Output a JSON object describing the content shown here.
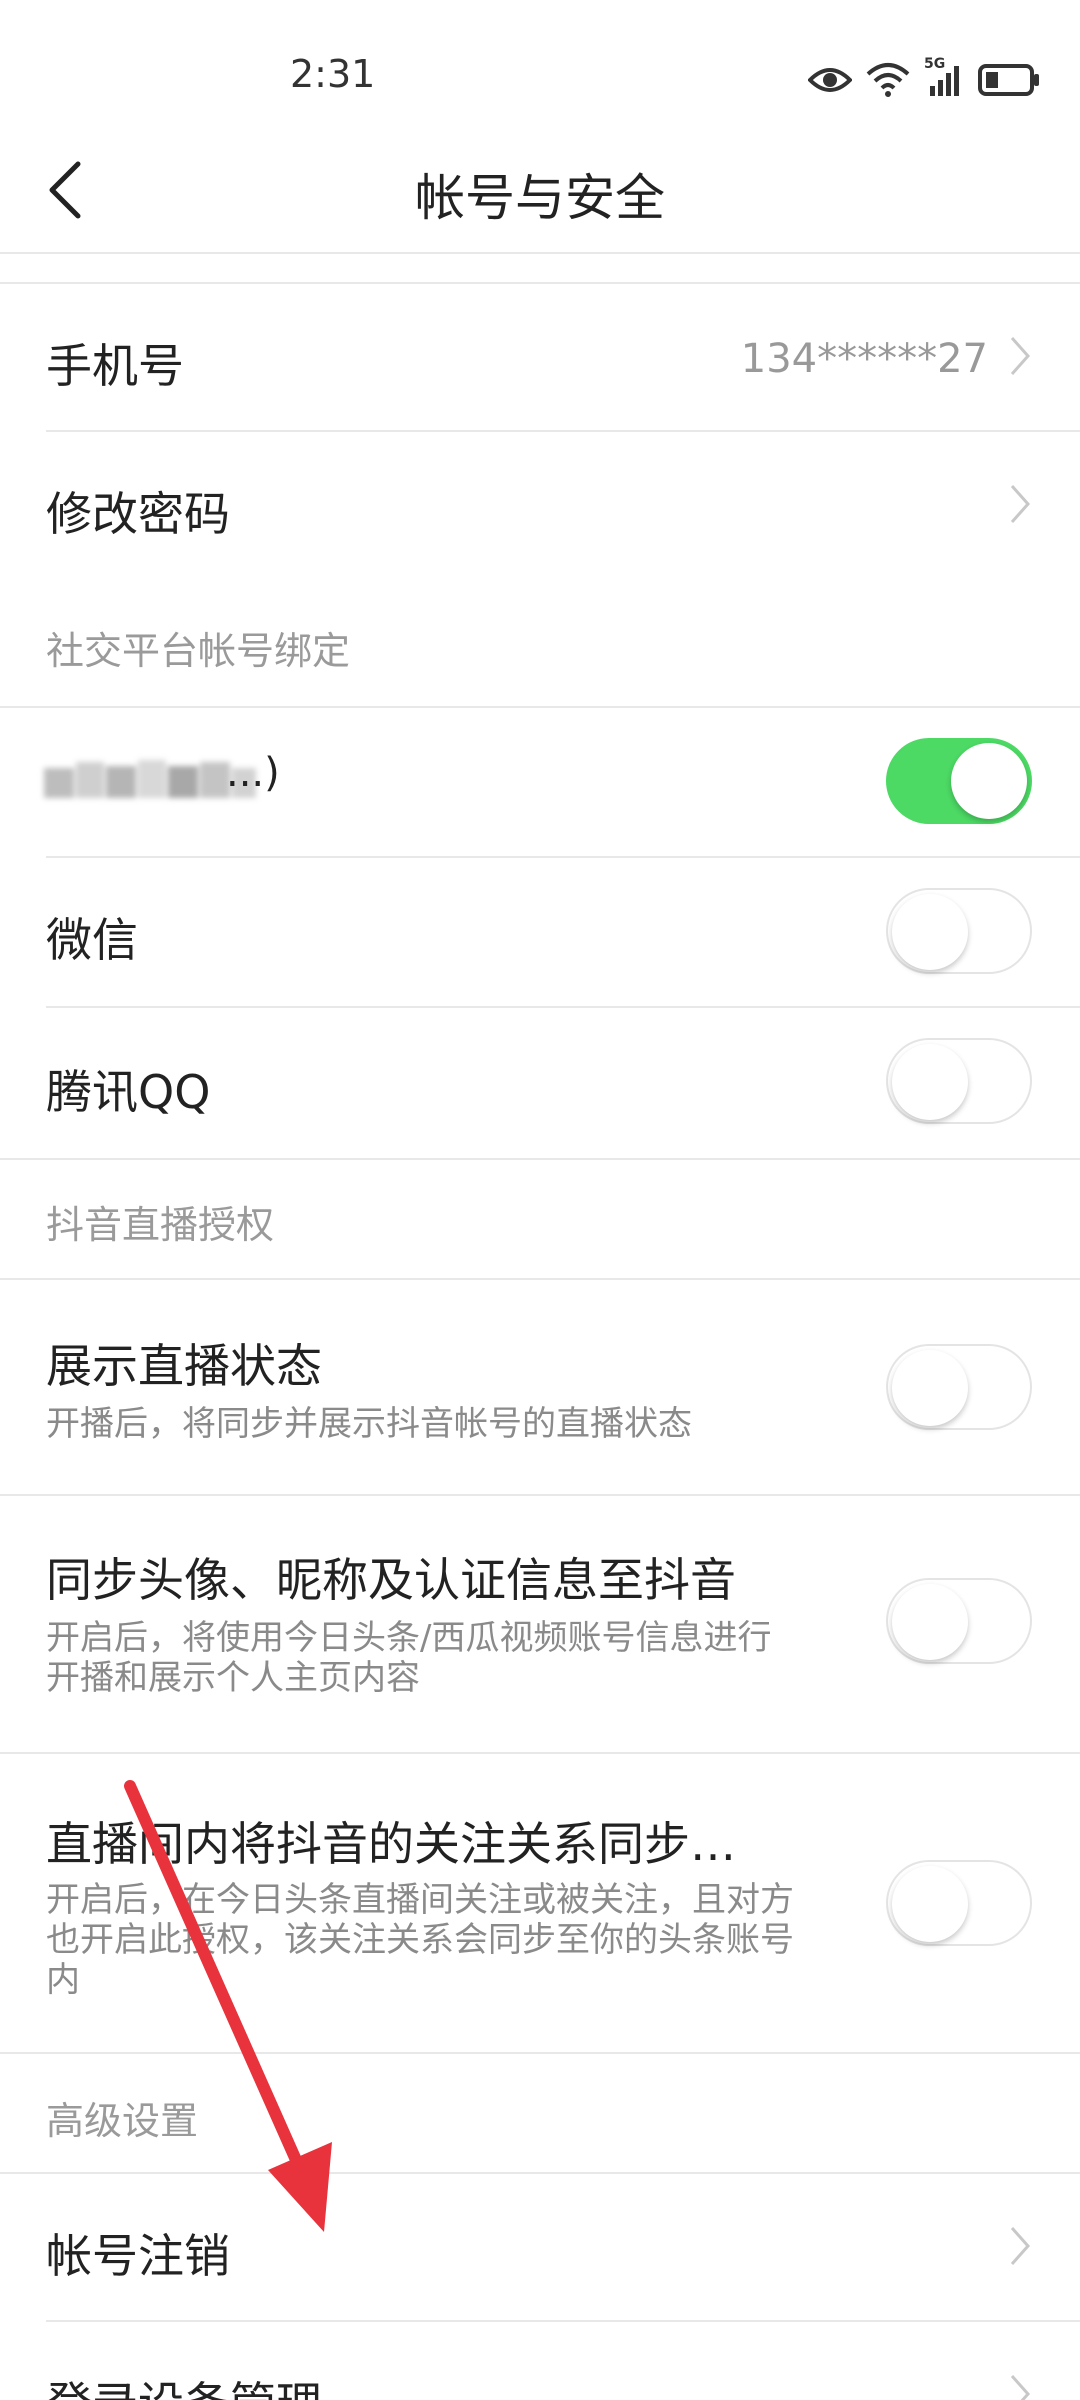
{
  "status_bar": {
    "time": "2:31",
    "network": "5G"
  },
  "nav": {
    "title": "帐号与安全"
  },
  "rows": {
    "phone": {
      "label": "手机号",
      "value": "134******27"
    },
    "password": {
      "label": "修改密码"
    },
    "social_header": "社交平台帐号绑定",
    "bound_account": {
      "label_visible": "...)",
      "enabled": true
    },
    "wechat": {
      "label": "微信",
      "enabled": false
    },
    "qq": {
      "label": "腾讯QQ",
      "enabled": false
    },
    "douyin_header": "抖音直播授权",
    "show_live": {
      "label": "展示直播状态",
      "sub": "开播后，将同步并展示抖音帐号的直播状态",
      "enabled": false
    },
    "sync_profile": {
      "label": "同步头像、昵称及认证信息至抖音",
      "sub": "开启后，将使用今日头条/西瓜视频账号信息进行开播和展示个人主页内容",
      "enabled": false
    },
    "sync_follow": {
      "label": "直播间内将抖音的关注关系同步…",
      "sub": "开启后，在今日头条直播间关注或被关注，且对方也开启此授权，该关注关系会同步至你的头条账号内",
      "enabled": false
    },
    "advanced_header": "高级设置",
    "deactivate": {
      "label": "帐号注销"
    },
    "devices": {
      "label": "登录设备管理"
    }
  },
  "colors": {
    "accent_green": "#4cd964",
    "annotation_arrow": "#e8323c"
  }
}
